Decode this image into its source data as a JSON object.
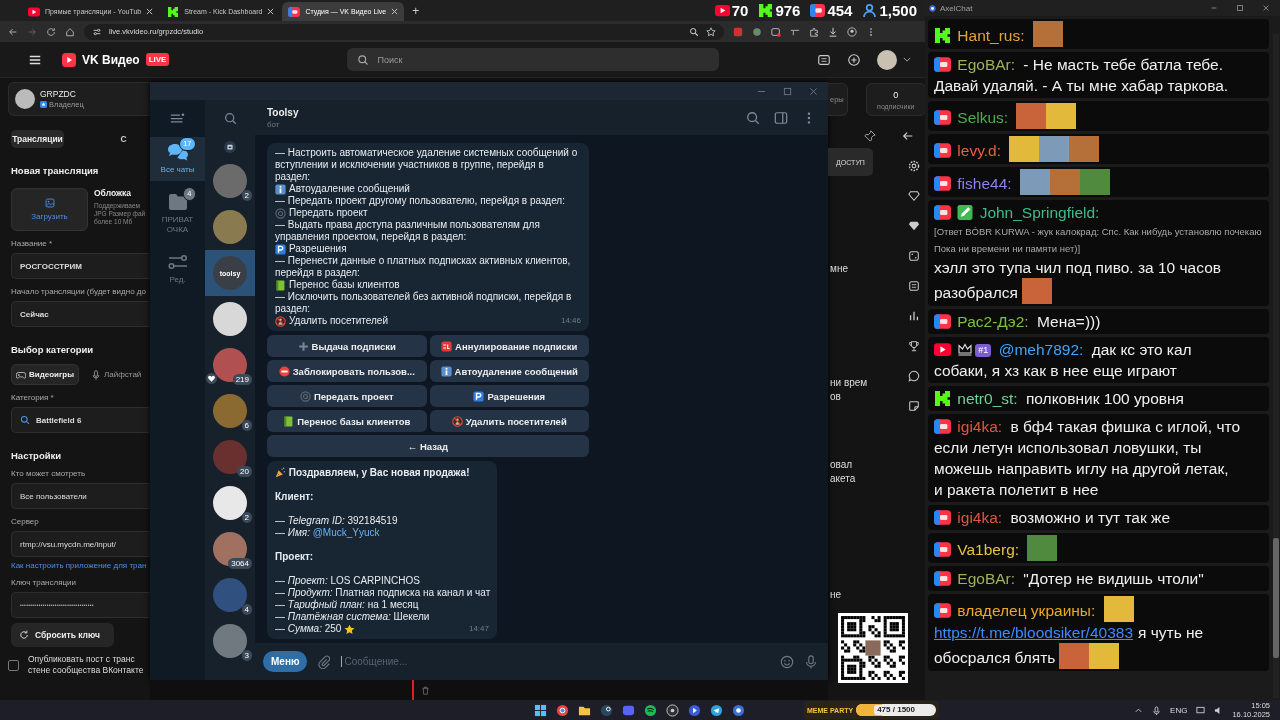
{
  "browser": {
    "tabs": [
      {
        "title": "Прямые трансляции - YouTub",
        "kind": "youtube",
        "selected": false
      },
      {
        "title": "Stream - Kick Dashboard",
        "kind": "kick",
        "selected": false
      },
      {
        "title": "Студия — VK Видео Live",
        "kind": "vk",
        "selected": true
      }
    ],
    "new_tab": "+",
    "stream_stats": [
      {
        "kind": "youtube",
        "count": "70"
      },
      {
        "kind": "kick",
        "count": "976"
      },
      {
        "kind": "vk",
        "count": "454"
      },
      {
        "kind": "viewers",
        "count": "1,500"
      }
    ],
    "address": "live.vkvideo.ru/grpzdc/studio"
  },
  "vk": {
    "logo": "VK Видео",
    "logo_badge": "LIVE",
    "search_placeholder": "Поиск",
    "owner": {
      "name": "GRPZDC",
      "role": "Владелец"
    },
    "tabs": [
      {
        "label": "Трансляции",
        "selected": true
      },
      {
        "label": "С",
        "selected": false
      }
    ],
    "heading": "Новая трансляция",
    "upload": "Загрузить",
    "cover_title": "Обложка",
    "cover_hint": [
      "Поддерживаем",
      "JPG Размер фай",
      "более 10 Мб"
    ],
    "title_label": "Название *",
    "title_value": "РОСГОССТРИМ",
    "start_label": "Начало трансляции (будет видно до",
    "start_value": "Сейчас",
    "category_heading": "Выбор категории",
    "category_types": [
      {
        "label": "Видеоигры",
        "kind": "gamepad",
        "selected": true
      },
      {
        "label": "Лайфстай",
        "kind": "mic",
        "selected": false
      }
    ],
    "category_label": "Категория *",
    "category_value": "Battlefield 6",
    "settings_heading": "Настройки",
    "audience_label": "Кто может смотреть",
    "audience_value": "Все пользователи",
    "server_label": "Сервер",
    "server_value": "rtmp://vsu.mycdn.me/input/",
    "help_link": "Как настроить приложение для тран",
    "key_label": "Ключ трансляции",
    "key_value": "••••••••••••••••••••••••••••••••••••",
    "reset_button": "Сбросить ключ",
    "publish": {
      "checked": false,
      "lines": [
        "Опубликовать пост с транс",
        "стене сообщества ВКонтакте"
      ]
    }
  },
  "vk_right": {
    "stat_fragment": "еры",
    "subscribers": {
      "value": "0",
      "label": "подписчики"
    },
    "access_button": "ДОСТУП",
    "fragments": [
      [
        "мне"
      ],
      [
        "ни врем",
        "ов"
      ],
      [
        "овал",
        "акета"
      ],
      [
        "не"
      ]
    ]
  },
  "telegram": {
    "folders": [
      {
        "label": "Все чаты",
        "badge": "17",
        "kind": "chats",
        "selected": true
      },
      {
        "label": "ПРИВАТ ОЧКА",
        "badge": "4",
        "kind": "folder",
        "selected": false
      },
      {
        "label": "Ред.",
        "kind": "edit",
        "selected": false
      }
    ],
    "chats": [
      {
        "badge": "2",
        "reaction": false,
        "selected": false
      },
      {
        "reaction": false,
        "selected": false
      },
      {
        "logo": "toolsy",
        "reaction": false,
        "selected": true
      },
      {
        "reaction": false,
        "selected": false
      },
      {
        "badge": "219",
        "reaction": true,
        "selected": false
      },
      {
        "badge": "6",
        "reaction": false,
        "selected": false
      },
      {
        "badge": "20",
        "reaction": false,
        "selected": false
      },
      {
        "badge": "2",
        "reaction": false,
        "selected": false
      },
      {
        "badge": "3064",
        "reaction": false,
        "selected": false
      },
      {
        "badge": "4",
        "reaction": false,
        "selected": false
      },
      {
        "badge": "3",
        "reaction": false,
        "selected": false
      }
    ],
    "chat": {
      "title": "Toolsy",
      "subtitle": "бот",
      "bot_message": {
        "items": [
          {
            "text": "— Настроить автоматическое удаление системных сообщений о вступлении и исключении участников в группе, перейдя в раздел:",
            "kind": "info",
            "label": "Автоудаление сообщений"
          },
          {
            "text": "— Передать проект другому пользователю, перейдя в раздел:",
            "kind": "ring",
            "label": "Передать проект"
          },
          {
            "text": "— Выдать права доступа различным пользователям для управления проектом, перейдя в раздел:",
            "kind": "parking",
            "label": "Разрешения"
          },
          {
            "text": "— Перенести данные о платных подписках активных клиентов, перейдя в раздел:",
            "kind": "book",
            "label": "Перенос базы клиентов"
          },
          {
            "text": "— Исключить пользователей без активной подписки, перейдя в раздел:",
            "kind": "noperson",
            "label": "Удалить посетителей"
          }
        ],
        "time": "14:46"
      },
      "keyboard": [
        {
          "kind": "plus",
          "label": "Выдача подписки"
        },
        {
          "kind": "cl",
          "label": "Аннулирование подписки"
        },
        {
          "kind": "stop",
          "label": "Заблокировать пользов..."
        },
        {
          "kind": "info",
          "label": "Автоудаление сообщений"
        },
        {
          "kind": "ring",
          "label": "Передать проект"
        },
        {
          "kind": "parking",
          "label": "Разрешения"
        },
        {
          "kind": "book",
          "label": "Перенос базы клиентов"
        },
        {
          "kind": "noperson",
          "label": "Удалить посетителей"
        }
      ],
      "back_button": "← Назад",
      "sale_message": {
        "heading": "Поздравляем, у Вас новая продажа!",
        "sections": [
          {
            "title": "Клиент:",
            "lines": [
              {
                "text": "— *Telegram ID:* 392184519"
              },
              {
                "text": "— *Имя:* ",
                "link": "@Muck_Yyuck"
              }
            ]
          },
          {
            "title": "Проект:",
            "lines": [
              {
                "text": "— *Проект:* LOS CARPINCHOS"
              },
              {
                "text": "— *Продукт:* Платная подписка на канал и чат"
              },
              {
                "text": "— *Тарифный план:* на 1 месяц"
              },
              {
                "text": "— *Платёжная система:* Шекели"
              },
              {
                "text": "— *Сумма:* 250",
                "star": true
              }
            ]
          }
        ],
        "time": "14:47"
      },
      "menu_button": "Меню",
      "placeholder": "Сообщение..."
    }
  },
  "axelchat": {
    "title": "AxelChat",
    "messages": [
      {
        "kind": "kick",
        "author": "Hant_rus:",
        "color": "#e8a13c",
        "parts": [
          {
            "kind": "emote"
          }
        ]
      },
      {
        "kind": "vk",
        "author": "EgoBAr:",
        "color": "#9fb05a",
        "parts": [
          {
            "kind": "text",
            "text": "- Не масть тебе батла тебе."
          },
          {
            "kind": "text",
            "text": "Давай удаляй. - А ты мне хабар таркова."
          }
        ]
      },
      {
        "kind": "vk",
        "author": "Selkus:",
        "color": "#4cae4f",
        "parts": [
          {
            "kind": "emote"
          },
          {
            "kind": "emote"
          }
        ]
      },
      {
        "kind": "vk",
        "author": "levy.d:",
        "color": "#e0643c",
        "parts": [
          {
            "kind": "emote"
          },
          {
            "kind": "emote"
          },
          {
            "kind": "emote"
          }
        ]
      },
      {
        "kind": "vk",
        "author": "fishe44:",
        "color": "#8d7ff0",
        "parts": [
          {
            "kind": "emote"
          },
          {
            "kind": "emote"
          },
          {
            "kind": "emote"
          }
        ]
      },
      {
        "kind": "vk",
        "author": "John_Springfield:",
        "color": "#3dbd8c",
        "badges": [
          {
            "kind": "pencil"
          }
        ],
        "reply": "[Ответ BÓBR KURWA - жук калокрад: Спс. Как нибудь установлю почекаю Пока ни времени ни памяти нет)]",
        "parts": [
          {
            "kind": "text",
            "text": "хэлл это тупа чил под пиво. за 10 часов"
          },
          {
            "kind": "text",
            "text": "разобрался"
          },
          {
            "kind": "emote"
          }
        ]
      },
      {
        "kind": "vk",
        "author": "Рас2-Дэ2:",
        "color": "#7cc142",
        "parts": [
          {
            "kind": "text",
            "text": "Мена=)))"
          }
        ]
      },
      {
        "kind": "youtube",
        "author": "@meh7892:",
        "color": "#3ea6ff",
        "badges": [
          {
            "kind": "crown"
          },
          {
            "kind": "rank",
            "text": "#1"
          }
        ],
        "parts": [
          {
            "kind": "text",
            "text": "дак кс это кал"
          },
          {
            "kind": "text",
            "text": "собаки, я хз как в нее еще играют"
          }
        ]
      },
      {
        "kind": "kick",
        "author": "netr0_st:",
        "color": "#6fd39a",
        "parts": [
          {
            "kind": "text",
            "text": "полковник 100 уровня"
          }
        ]
      },
      {
        "kind": "vk",
        "author": "igi4ka:",
        "color": "#e2553e",
        "parts": [
          {
            "kind": "text",
            "text": "в бф4 такая фишка с иглой, что"
          },
          {
            "kind": "text",
            "text": "если летун использовал ловушки, ты"
          },
          {
            "kind": "text",
            "text": "можешь направить иглу на другой летак,"
          },
          {
            "kind": "text",
            "text": "и ракета полетит в нее"
          }
        ]
      },
      {
        "kind": "vk",
        "author": "igi4ka:",
        "color": "#e2553e",
        "parts": [
          {
            "kind": "text",
            "text": "возможно и тут так же"
          }
        ]
      },
      {
        "kind": "vk",
        "author": "Va1berg:",
        "color": "#e6c53a",
        "parts": [
          {
            "kind": "emote"
          }
        ]
      },
      {
        "kind": "vk",
        "author": "EgoBAr:",
        "color": "#9fb05a",
        "parts": [
          {
            "kind": "text",
            "text": "\"Дотер не видишь чтоли\""
          }
        ]
      },
      {
        "kind": "vk",
        "author": "владелец украины:",
        "color": "#f0a820",
        "parts": [
          {
            "kind": "emote"
          },
          {
            "kind": "link",
            "text": "https://t.me/bloodsiker/40383"
          },
          {
            "kind": "text",
            "text": "я чуть не"
          },
          {
            "kind": "text",
            "text": "обосрался блять"
          },
          {
            "kind": "emote"
          },
          {
            "kind": "emote"
          }
        ]
      }
    ]
  },
  "overlay": {
    "goal": {
      "title": "MEME PARTY",
      "text": "475 / 1500",
      "level": 0.32
    }
  },
  "taskbar": {
    "lang": "ENG",
    "time": "15:05",
    "date": "16.10.2025"
  }
}
